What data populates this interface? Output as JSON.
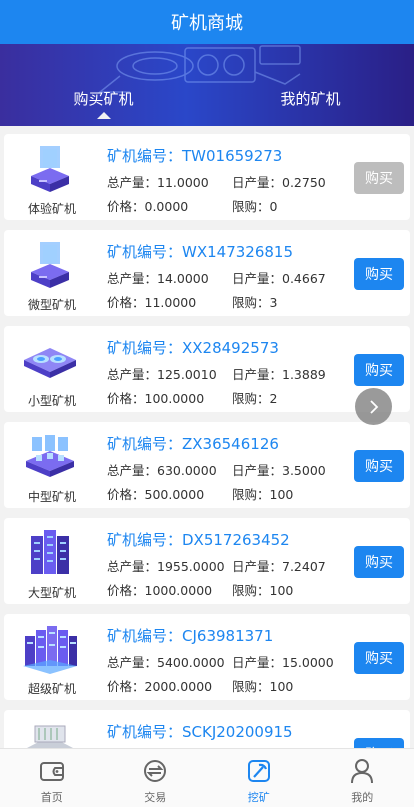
{
  "header": {
    "title": "矿机商城"
  },
  "tabs": [
    {
      "label": "购买矿机",
      "active": true
    },
    {
      "label": "我的矿机",
      "active": false
    }
  ],
  "miners": [
    {
      "type": "体验矿机",
      "id_label": "矿机编号：TW01659273",
      "total": "总产量：11.0000",
      "daily": "日产量：0.2750",
      "price": "价格：0.0000",
      "limit": "限购：0",
      "buy": "购买",
      "disabled": true,
      "icon": "experience-miner-icon"
    },
    {
      "type": "微型矿机",
      "id_label": "矿机编号：WX147326815",
      "total": "总产量：14.0000",
      "daily": "日产量：0.4667",
      "price": "价格：11.0000",
      "limit": "限购：3",
      "buy": "购买",
      "disabled": false,
      "icon": "micro-miner-icon"
    },
    {
      "type": "小型矿机",
      "id_label": "矿机编号：XX28492573",
      "total": "总产量：125.0010",
      "daily": "日产量：1.3889",
      "price": "价格：100.0000",
      "limit": "限购：2",
      "buy": "购买",
      "disabled": false,
      "icon": "small-miner-icon"
    },
    {
      "type": "中型矿机",
      "id_label": "矿机编号：ZX36546126",
      "total": "总产量：630.0000",
      "daily": "日产量：3.5000",
      "price": "价格：500.0000",
      "limit": "限购：100",
      "buy": "购买",
      "disabled": false,
      "icon": "medium-miner-icon"
    },
    {
      "type": "大型矿机",
      "id_label": "矿机编号：DX517263452",
      "total": "总产量：1955.0000",
      "daily": "日产量：7.2407",
      "price": "价格：1000.0000",
      "limit": "限购：100",
      "buy": "购买",
      "disabled": false,
      "icon": "large-miner-icon"
    },
    {
      "type": "超级矿机",
      "id_label": "矿机编号：CJ63981371",
      "total": "总产量：5400.0000",
      "daily": "日产量：15.0000",
      "price": "价格：2000.0000",
      "limit": "限购：100",
      "buy": "购买",
      "disabled": false,
      "icon": "super-miner-icon"
    },
    {
      "type": "",
      "id_label": "矿机编号：SCKJ20200915",
      "total": "",
      "daily": "",
      "price": "",
      "limit": "",
      "buy": "购买",
      "disabled": false,
      "icon": "partial-miner-icon"
    }
  ],
  "nav": [
    {
      "label": "首页",
      "icon": "wallet-icon",
      "active": false
    },
    {
      "label": "交易",
      "icon": "exchange-icon",
      "active": false
    },
    {
      "label": "挖矿",
      "icon": "mining-icon",
      "active": true
    },
    {
      "label": "我的",
      "icon": "user-icon",
      "active": false
    }
  ],
  "colors": {
    "primary": "#1d86f0",
    "disabled": "#bdbdbd",
    "banner_start": "#3a2e9e",
    "banner_end": "#2a1f86"
  }
}
